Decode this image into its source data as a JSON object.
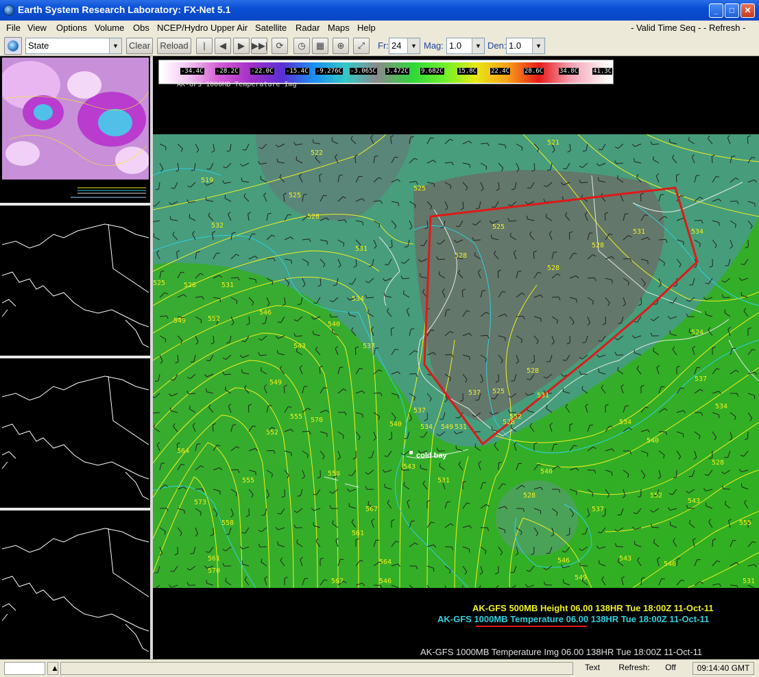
{
  "window": {
    "title": "Earth System Research Laboratory: FX-Net 5.1"
  },
  "menu": {
    "items": [
      "File",
      "View",
      "Options",
      "Volume",
      "Obs",
      "NCEP/Hydro",
      "Upper Air",
      "Satellite",
      "Radar",
      "Maps",
      "Help"
    ],
    "right": [
      "- Valid Time Seq -",
      "- Refresh -"
    ]
  },
  "toolbar": {
    "scale_value": "State",
    "clear_label": "Clear",
    "reload_label": "Reload",
    "fr_label": "Fr:",
    "fr_value": "24",
    "mag_label": "Mag:",
    "mag_value": "1.0",
    "den_label": "Den:",
    "den_value": "1.0",
    "icons": [
      "first-frame-icon",
      "prev-frame-icon",
      "next-frame-icon",
      "last-frame-icon",
      "loop-icon",
      "clock-icon",
      "image-icon",
      "crosshair-icon",
      "zoom-icon"
    ]
  },
  "colorbar": {
    "ticks": [
      "-34.4C",
      "-28.2C",
      "-22.0C",
      "-15.4C",
      "-9.276C",
      "-3.065C",
      "3.472C",
      "9.682C",
      "15.8C",
      "22.4C",
      "28.6C",
      "34.8C",
      "41.3C"
    ],
    "title": "AK-GFS 1000MB Temperature Img"
  },
  "map": {
    "station": "cold bay",
    "height_labels": [
      "522",
      "521",
      "519",
      "525",
      "525",
      "528",
      "532",
      "531",
      "528",
      "528",
      "525",
      "528",
      "531",
      "534",
      "525",
      "528",
      "531",
      "534",
      "537",
      "540",
      "543",
      "546",
      "549",
      "552",
      "555",
      "558",
      "561",
      "564",
      "567",
      "570",
      "573",
      "546",
      "549",
      "552",
      "555",
      "558",
      "561",
      "564",
      "567",
      "570",
      "537",
      "540",
      "543",
      "531",
      "528",
      "525",
      "528",
      "531",
      "534",
      "537",
      "540",
      "543",
      "546",
      "549",
      "552",
      "555",
      "531",
      "534",
      "537",
      "540",
      "543",
      "546",
      "549",
      "552",
      "537",
      "534",
      "531",
      "528",
      "524",
      "528"
    ]
  },
  "legends": {
    "height": "AK-GFS 500MB Height  06.00 138HR Tue 18:00Z 11-Oct-11",
    "temperature": "AK-GFS 1000MB Temperature  06.00 138HR Tue 18:00Z 11-Oct-11",
    "image": "AK-GFS 1000MB Temperature Img 06.00 138HR Tue 18:00Z 11-Oct-11"
  },
  "status": {
    "text_label": "Text",
    "refresh_label": "Refresh:",
    "refresh_value": "Off",
    "clock": "09:14:40 GMT"
  },
  "colors": {
    "height_contour": "#f0f020",
    "temp_contour": "#30d0e0",
    "annotation": "#e01818",
    "land_green": "#3aaa30"
  }
}
